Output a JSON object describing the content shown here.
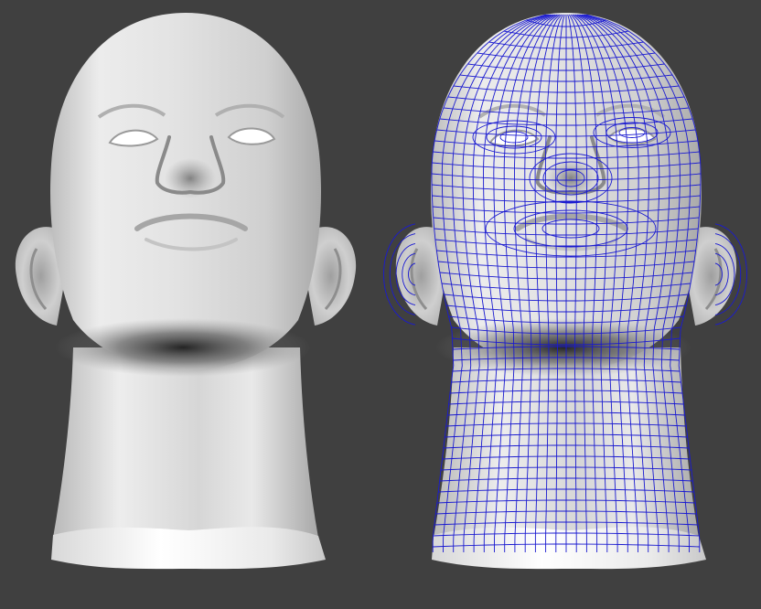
{
  "scene": {
    "background_color": "#404040",
    "models": [
      {
        "id": "smooth-shaded-head",
        "shading": "smooth",
        "wireframe": false,
        "base_color": "#d9d9d9"
      },
      {
        "id": "wireframe-shaded-head",
        "shading": "smooth",
        "wireframe": true,
        "base_color": "#d9d9d9",
        "wire_color": "#1a1ad0"
      }
    ]
  }
}
